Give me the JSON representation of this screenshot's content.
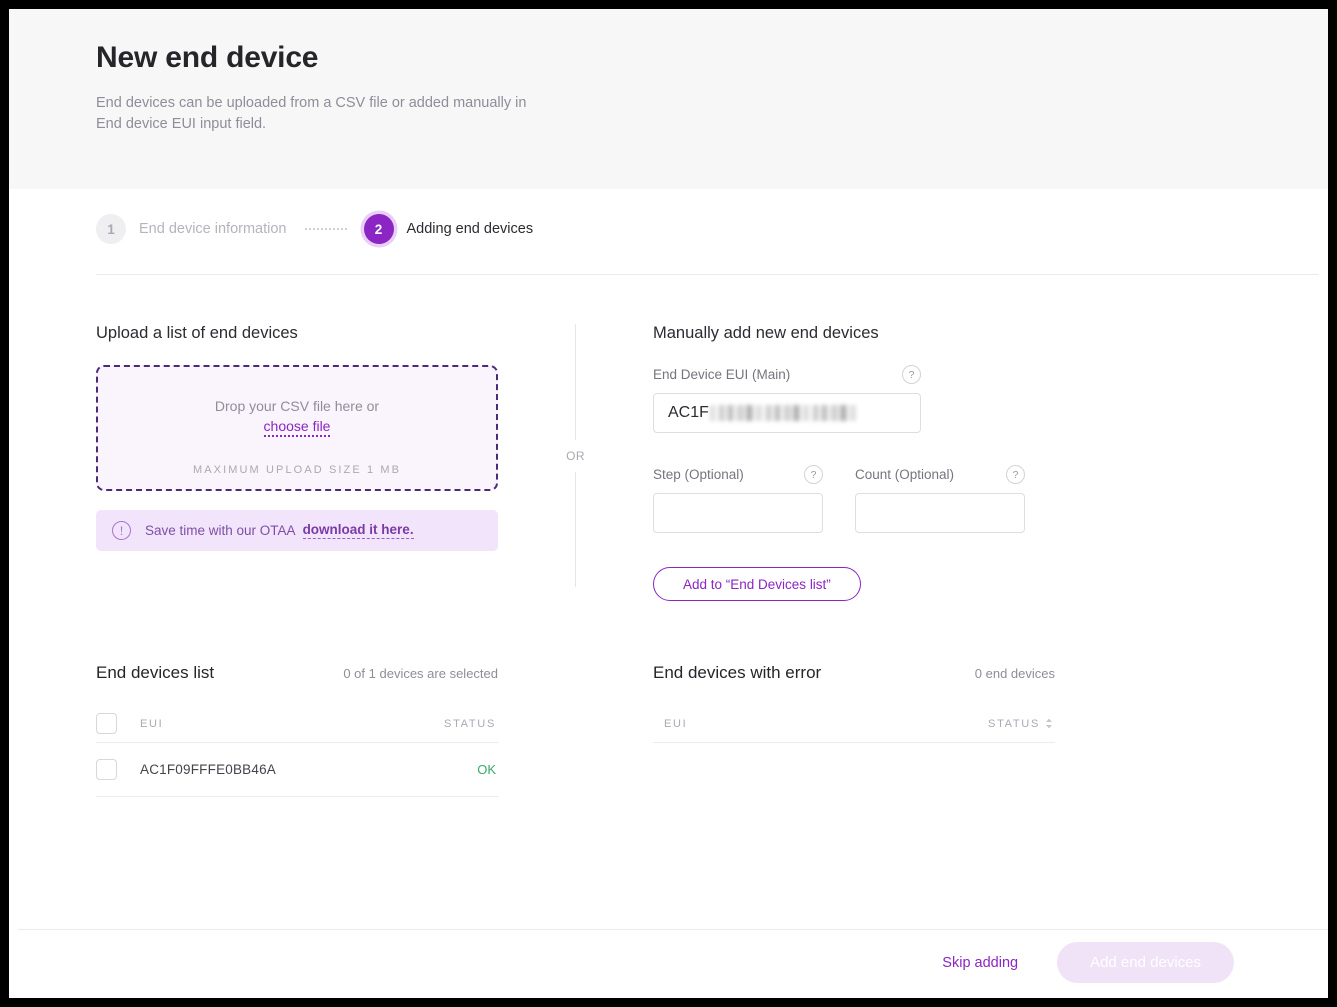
{
  "header": {
    "title": "New end device",
    "subtitle": "End devices can be uploaded from a CSV file or added manually in\nEnd device EUI input field."
  },
  "stepper": {
    "steps": [
      {
        "number": "1",
        "label": "End device information",
        "state": "done"
      },
      {
        "number": "2",
        "label": "Adding end devices",
        "state": "active"
      }
    ]
  },
  "upload": {
    "heading": "Upload a list of end devices",
    "dropzone_text": "Drop your CSV file here or",
    "dropzone_link": "choose file",
    "max_size_note": "MAXIMUM UPLOAD SIZE 1 MB",
    "notice": {
      "icon": "exclamation-circle-icon",
      "text": "Save time with our OTAA",
      "link": "download it here."
    }
  },
  "divider": {
    "label": "OR"
  },
  "manual": {
    "heading": "Manually add new end devices",
    "eui_field": {
      "label": "End Device EUI (Main)",
      "value_visible": "AC1F",
      "value_redacted": true,
      "help": "?"
    },
    "step_field": {
      "label": "Step (Optional)",
      "value": "",
      "help": "?"
    },
    "count_field": {
      "label": "Count (Optional)",
      "value": "",
      "help": "?"
    },
    "add_button": "Add to “End Devices list”"
  },
  "devices_table": {
    "title": "End devices list",
    "count_text": "0 of 1 devices are selected",
    "columns": [
      "EUI",
      "STATUS"
    ],
    "rows": [
      {
        "eui": "AC1F09FFFE0BB46A",
        "status": "OK",
        "selected": false
      }
    ]
  },
  "errors_table": {
    "title": "End devices with error",
    "count_text": "0 end devices",
    "columns": [
      "EUI",
      "STATUS"
    ],
    "rows": []
  },
  "footer": {
    "skip_label": "Skip adding",
    "submit_label": "Add end devices",
    "submit_disabled": true
  },
  "colors": {
    "accent": "#8b25c4",
    "accent_light": "#f2e4fa",
    "status_ok": "#3aa96a",
    "hero_bg": "#f7f7f8",
    "dropzone_bg": "#faf4fd"
  }
}
